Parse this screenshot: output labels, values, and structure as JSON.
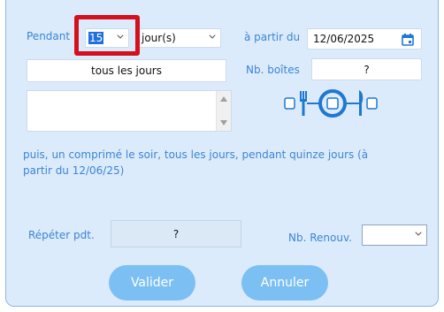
{
  "form": {
    "pendant_label": "Pendant",
    "duration_value": "15",
    "unit_value": "jour(s)",
    "start_label": "à partir du",
    "start_date": "12/06/2025",
    "frequency_value": "tous les jours",
    "boxes_label": "Nb. boîtes",
    "boxes_value": "?",
    "summary": "puis, un comprimé le soir, tous les jours, pendant quinze jours (à partir du 12/06/25)",
    "repeat_label": "Répéter pdt.",
    "repeat_value": "?",
    "renew_label": "Nb. Renouv.",
    "renew_value": ""
  },
  "buttons": {
    "validate": "Valider",
    "cancel": "Annuler"
  },
  "colors": {
    "panel_bg": "#dcebfb",
    "label_blue": "#3a86d6",
    "button_blue": "#7cc0f3",
    "highlight_red": "#d3101b",
    "meal_icon_blue": "#1e78d2"
  },
  "icons": [
    "calendar-icon",
    "fork-icon",
    "plate-icon",
    "knife-icon",
    "chevron-down-icon"
  ]
}
